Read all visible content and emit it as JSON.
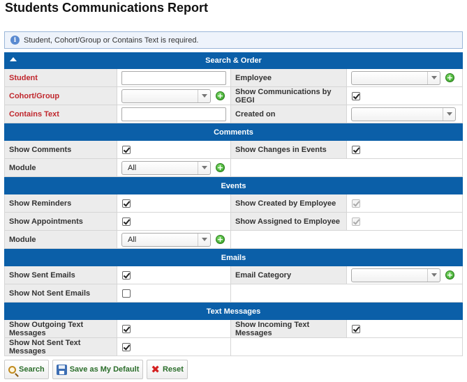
{
  "page": {
    "title": "Students Communications Report"
  },
  "notice": {
    "text": "Student, Cohort/Group or Contains Text is required."
  },
  "search_order": {
    "header": "Search & Order",
    "student_label": "Student",
    "employee_label": "Employee",
    "cohort_label": "Cohort/Group",
    "show_by_gegi_label": "Show Communications by GEGI",
    "show_by_gegi_checked": true,
    "contains_text_label": "Contains Text",
    "created_on_label": "Created on",
    "student_value": "",
    "contains_text_value": "",
    "employee_value": "",
    "cohort_value": "",
    "created_on_value": ""
  },
  "comments": {
    "header": "Comments",
    "show_comments_label": "Show Comments",
    "show_comments_checked": true,
    "show_changes_label": "Show Changes in Events",
    "show_changes_checked": true,
    "module_label": "Module",
    "module_value": "All"
  },
  "events": {
    "header": "Events",
    "show_reminders_label": "Show Reminders",
    "show_reminders_checked": true,
    "show_created_by_label": "Show Created by Employee",
    "show_created_by_checked": true,
    "show_appointments_label": "Show Appointments",
    "show_appointments_checked": true,
    "show_assigned_label": "Show Assigned to Employee",
    "show_assigned_checked": true,
    "module_label": "Module",
    "module_value": "All"
  },
  "emails": {
    "header": "Emails",
    "show_sent_label": "Show Sent Emails",
    "show_sent_checked": true,
    "email_category_label": "Email Category",
    "email_category_value": "",
    "show_not_sent_label": "Show Not Sent Emails",
    "show_not_sent_checked": false
  },
  "text_messages": {
    "header": "Text Messages",
    "show_outgoing_label": "Show Outgoing Text Messages",
    "show_outgoing_checked": true,
    "show_incoming_label": "Show Incoming Text Messages",
    "show_incoming_checked": true,
    "show_not_sent_label": "Show Not Sent Text Messages",
    "show_not_sent_checked": true
  },
  "buttons": {
    "search": "Search",
    "save_default": "Save as My Default",
    "reset": "Reset"
  },
  "icons": {
    "info": "info-icon",
    "collapse": "chevron-up-icon",
    "add": "plus-circle-icon",
    "dropdown": "chevron-down-icon",
    "search": "magnifier-icon",
    "save": "floppy-disk-icon",
    "reset": "red-x-icon"
  },
  "colors": {
    "section_header": "#0b5fa8",
    "required_label": "#c0272d",
    "label_background": "#ececec",
    "button_text": "#2b6e2b"
  }
}
